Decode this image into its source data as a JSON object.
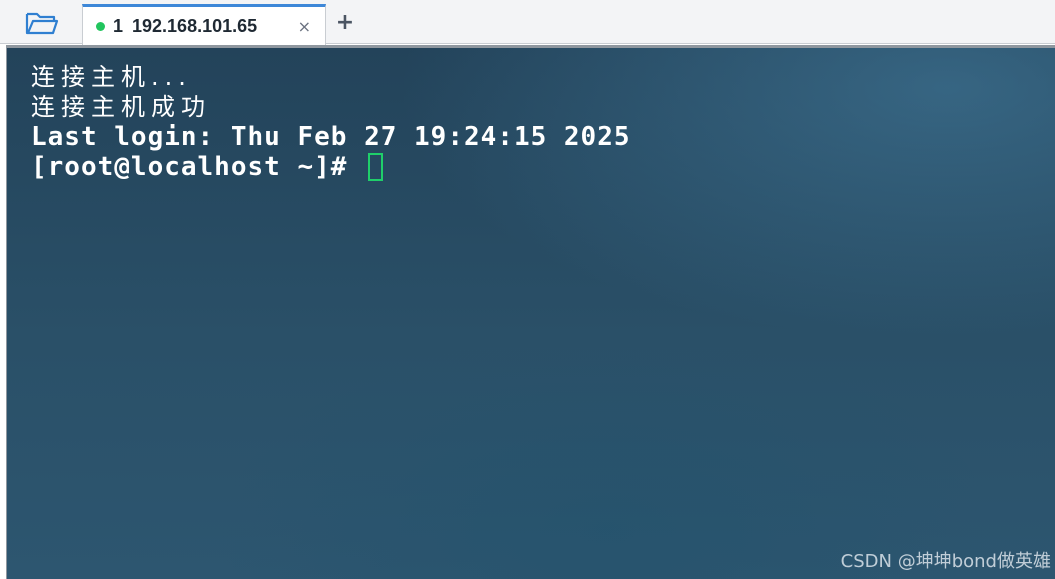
{
  "tabs": [
    {
      "index": "1",
      "title": "192.168.101.65",
      "status_color": "#22c55e",
      "close_glyph": "×"
    }
  ],
  "toolbar": {
    "folder_icon": "folder-open-icon",
    "add_tab_glyph": "+"
  },
  "terminal": {
    "lines": [
      "连接主机...",
      "连接主机成功",
      "Last login: Thu Feb 27 19:24:15 2025"
    ],
    "prompt": "[root@localhost ~]# ",
    "cursor_color": "#1fcf6a",
    "text_color": "#ffffff"
  },
  "watermark": "CSDN @坤坤bond做英雄"
}
